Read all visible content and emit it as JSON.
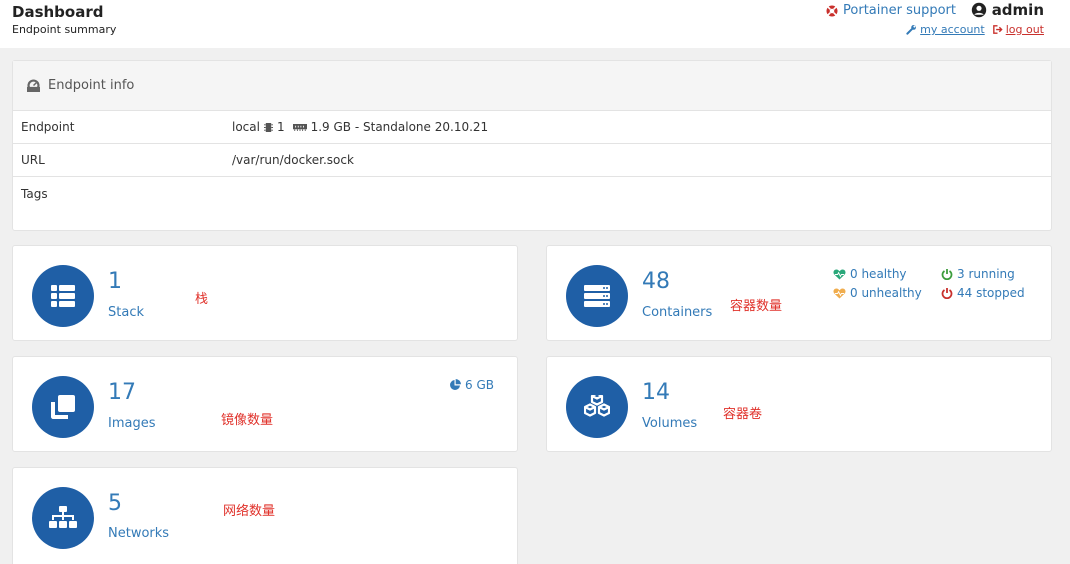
{
  "header": {
    "title": "Dashboard",
    "subtitle": "Endpoint summary",
    "support_label": "Portainer support",
    "username": "admin",
    "my_account": "my account",
    "logout": "log out"
  },
  "endpoint_info": {
    "heading": "Endpoint info",
    "rows": [
      {
        "key": "Endpoint",
        "value": "local",
        "cpu": "1",
        "memory": "1.9 GB - Standalone 20.10.21"
      },
      {
        "key": "URL",
        "value": "/var/run/docker.sock"
      },
      {
        "key": "Tags",
        "value": ""
      }
    ]
  },
  "cards": {
    "stack": {
      "count": "1",
      "label": "Stack",
      "note": "栈"
    },
    "containers": {
      "count": "48",
      "label": "Containers",
      "note": "容器数量",
      "healthy": "0 healthy",
      "unhealthy": "0 unhealthy",
      "running": "3 running",
      "stopped": "44 stopped"
    },
    "images": {
      "count": "17",
      "label": "Images",
      "note": "镜像数量",
      "size": "6 GB"
    },
    "volumes": {
      "count": "14",
      "label": "Volumes",
      "note": "容器卷"
    },
    "networks": {
      "count": "5",
      "label": "Networks",
      "note": "网络数量"
    }
  },
  "colors": {
    "accent": "#337ab7",
    "icon_circle": "#1f5fa6",
    "healthy": "#2aa87a",
    "unhealthy": "#f0ad4e",
    "running": "#3c9d3c",
    "stopped": "#c9302c",
    "annotation": "#e0312a"
  },
  "icons": {
    "support": "life-ring-icon",
    "user": "user-circle-icon",
    "account": "wrench-icon",
    "logout": "sign-out-icon",
    "endpoint_info": "tachometer-icon",
    "stack": "th-list-icon",
    "containers": "server-icon",
    "images": "clone-icon",
    "volumes": "cubes-icon",
    "networks": "sitemap-icon"
  }
}
